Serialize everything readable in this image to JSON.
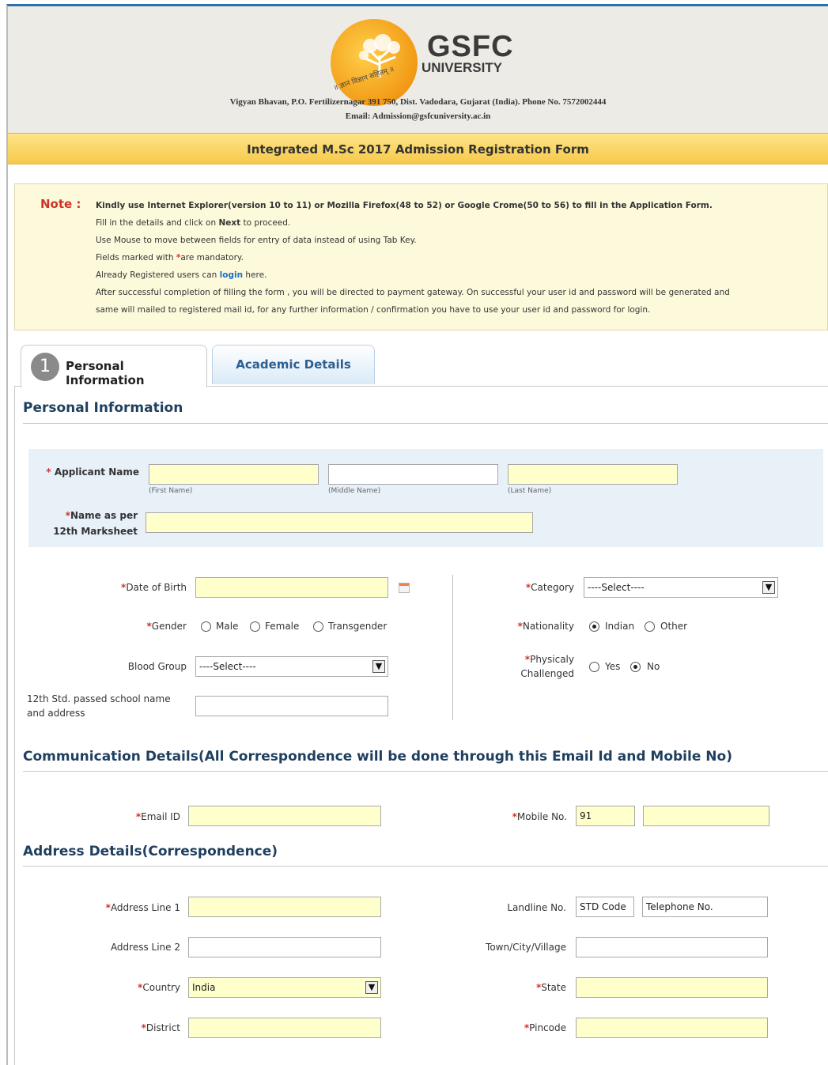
{
  "header": {
    "logo_text": "GSFC",
    "logo_sub": "UNIVERSITY",
    "logo_motto": "॥ ज्ञानं विज्ञान सहितम् ॥",
    "address": "Vigyan Bhavan, P.O. Fertilizernagar 391 750, Dist. Vadodara, Gujarat (India). Phone No. 7572002444",
    "email": "Email: Admission@gsfcuniversity.ac.in"
  },
  "form_title": "Integrated M.Sc 2017 Admission Registration Form",
  "note": {
    "label": "Note :",
    "line1": "Kindly use Internet Explorer(version 10 to 11) or Mozilla Firefox(48 to 52) or Google Crome(50 to 56) to fill in the Application Form.",
    "line2_a": "Fill in the details and click on ",
    "line2_b": "Next",
    "line2_c": " to proceed.",
    "line3": "Use Mouse to move between fields for entry of data instead of using Tab Key.",
    "line4_a": "Fields marked with ",
    "line4_star": "*",
    "line4_b": "are mandatory.",
    "line5_a": "Already Registered users can ",
    "line5_link": "login",
    "line5_b": " here.",
    "line6": "After successful completion of filling the form , you will be directed to payment gateway. On successful your user id and password will be generated and",
    "line7": "same will mailed to registered mail id, for any further information / confirmation you have to use your user id and password for login."
  },
  "tabs": {
    "active_number": "1",
    "active_label": "Personal Information",
    "inactive_label": "Academic Details"
  },
  "sections": {
    "personal": "Personal Information",
    "communication": "Communication Details(All Correspondence will be done through this Email Id and Mobile No)",
    "address": "Address Details(Correspondence)"
  },
  "star": "*",
  "fields": {
    "applicant_name": "Applicant Name",
    "first_name": "(First Name)",
    "middle_name": "(Middle Name)",
    "last_name": "(Last Name)",
    "name_12th_a": "Name as per",
    "name_12th_b": "12th Marksheet",
    "dob": "Date of Birth",
    "gender": "Gender",
    "gender_options": [
      "Male",
      "Female",
      "Transgender"
    ],
    "blood_group": "Blood Group",
    "blood_group_value": "----Select----",
    "school_a": "12th Std. passed school name",
    "school_b": "and address",
    "category": "Category",
    "category_value": "----Select----",
    "nationality": "Nationality",
    "nationality_options": [
      "Indian",
      "Other"
    ],
    "physically_a": "Physicaly",
    "physically_b": "Challenged",
    "physically_options": [
      "Yes",
      "No"
    ],
    "email": "Email ID",
    "mobile": "Mobile No.",
    "mobile_code": "91",
    "address1": "Address Line 1",
    "address2": "Address Line 2",
    "country": "Country",
    "country_value": "India",
    "district": "District",
    "landline": "Landline No.",
    "std_code": "STD Code",
    "telephone": "Telephone No.",
    "town": "Town/City/Village",
    "state": "State",
    "pincode": "Pincode"
  },
  "colors": {
    "title_bar": "#f7c94a",
    "note_bg": "#fdfadc",
    "required": "#d0332a",
    "link": "#1a6fc4",
    "input_required_bg": "#ffffcc"
  }
}
